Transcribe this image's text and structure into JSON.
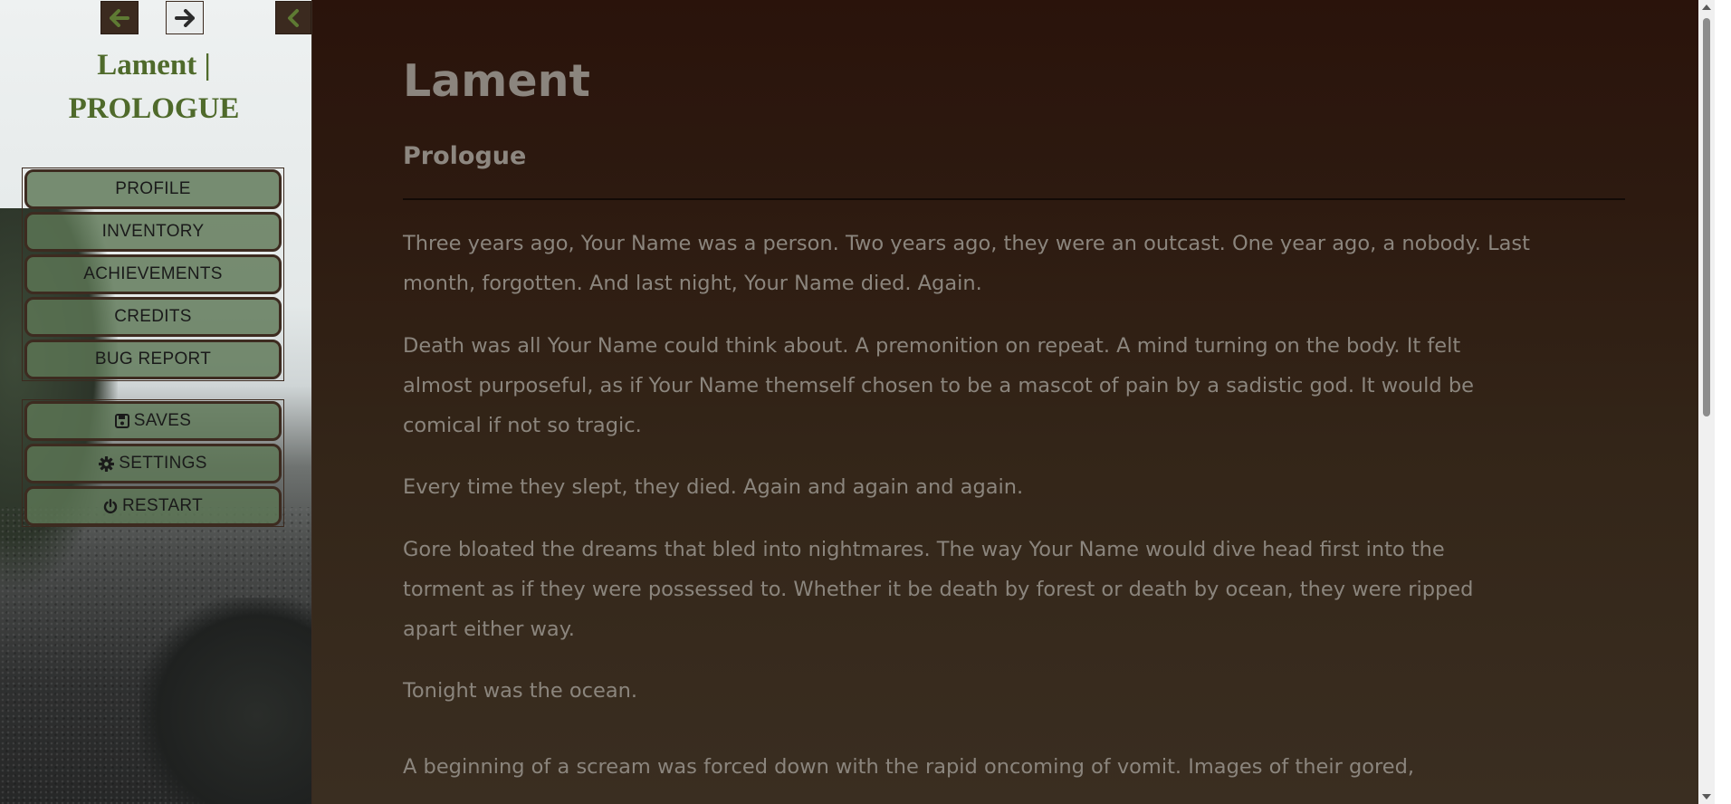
{
  "sidebar": {
    "story_title_line1": "Lament |",
    "story_title_line2": "PROLOGUE",
    "main_menu": [
      {
        "label": "PROFILE"
      },
      {
        "label": "INVENTORY"
      },
      {
        "label": "ACHIEVEMENTS"
      },
      {
        "label": "CREDITS"
      },
      {
        "label": "BUG REPORT"
      }
    ],
    "system_menu": [
      {
        "label": "SAVES",
        "icon": "floppy-disk-icon"
      },
      {
        "label": "SETTINGS",
        "icon": "gear-icon"
      },
      {
        "label": "RESTART",
        "icon": "power-icon"
      }
    ],
    "nav_icons": {
      "back": "arrow-left-icon",
      "forward": "arrow-right-icon",
      "collapse": "chevron-left-icon"
    },
    "colors": {
      "title": "#4f6a2b",
      "button_fill": "#5d7656",
      "button_border": "#3d2b20"
    }
  },
  "passage": {
    "title": "Lament",
    "subtitle": "Prologue",
    "paragraphs": [
      {
        "lines": [
          "Three years ago, Your Name was a person. Two years ago, they were an outcast. One year ago, a nobody. Last",
          "month, forgotten. And last night, Your Name died. Again."
        ]
      },
      {
        "lines": [
          "Death was all Your Name could think about. A premonition on repeat. A mind turning on the body. It felt",
          "almost purposeful, as if Your Name themself chosen to be a mascot of pain by a sadistic god. It would be",
          "comical if not so tragic."
        ]
      },
      {
        "lines": [
          "Every time they slept, they died. Again and again and again."
        ]
      },
      {
        "lines": [
          "Gore bloated the dreams that bled into nightmares. The way Your Name would dive head first into the",
          "torment as if they were possessed to. Whether it be death by forest or death by ocean, they were ripped",
          "apart either way."
        ]
      },
      {
        "lines": [
          "Tonight was the ocean."
        ]
      },
      {
        "lines": [
          "A beginning of a scream was forced down with the rapid oncoming of vomit. Images of their gored,"
        ]
      }
    ],
    "colors": {
      "text": "#8b857d",
      "background_top": "#2a130b",
      "background_bottom": "#3a2e21"
    }
  }
}
